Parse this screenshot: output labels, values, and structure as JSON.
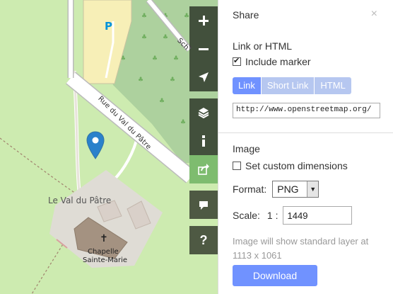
{
  "map": {
    "labels": {
      "road": "Rue du Val du Pâtre",
      "road_top": "Sch",
      "place": "Le Val du Pâtre",
      "chapel_line1": "Chapelle",
      "chapel_line2": "Sainte-Marie",
      "parking": "P"
    },
    "controls": {
      "zoom_in_icon": "plus-icon",
      "zoom_out_icon": "minus-icon",
      "locate_icon": "location-arrow-icon",
      "layers_icon": "layers-icon",
      "info_icon": "info-icon",
      "share_icon": "share-icon",
      "note_icon": "comment-icon",
      "help_label": "?"
    },
    "colors": {
      "grass": "#cdebb0",
      "forest": "#add19e",
      "parking": "#f7efb7",
      "active_control": "#7ebc6f"
    }
  },
  "sidebar": {
    "title": "Share",
    "close_label": "×",
    "link_section_label": "Link or HTML",
    "include_marker_label": "Include marker",
    "include_marker_checked": true,
    "tabs": [
      {
        "label": "Link",
        "active": true
      },
      {
        "label": "Short Link",
        "active": false
      },
      {
        "label": "HTML",
        "active": false
      }
    ],
    "url_value": "http://www.openstreetmap.org/",
    "image_section_label": "Image",
    "custom_dimensions_label": "Set custom dimensions",
    "custom_dimensions_checked": false,
    "format_label": "Format:",
    "format_value": "PNG",
    "scale_label": "Scale:",
    "scale_prefix": "1 :",
    "scale_value": "1449",
    "hint": "Image will show standard layer at 1113 x 1061",
    "download_label": "Download",
    "accent_color": "#7092ff"
  }
}
